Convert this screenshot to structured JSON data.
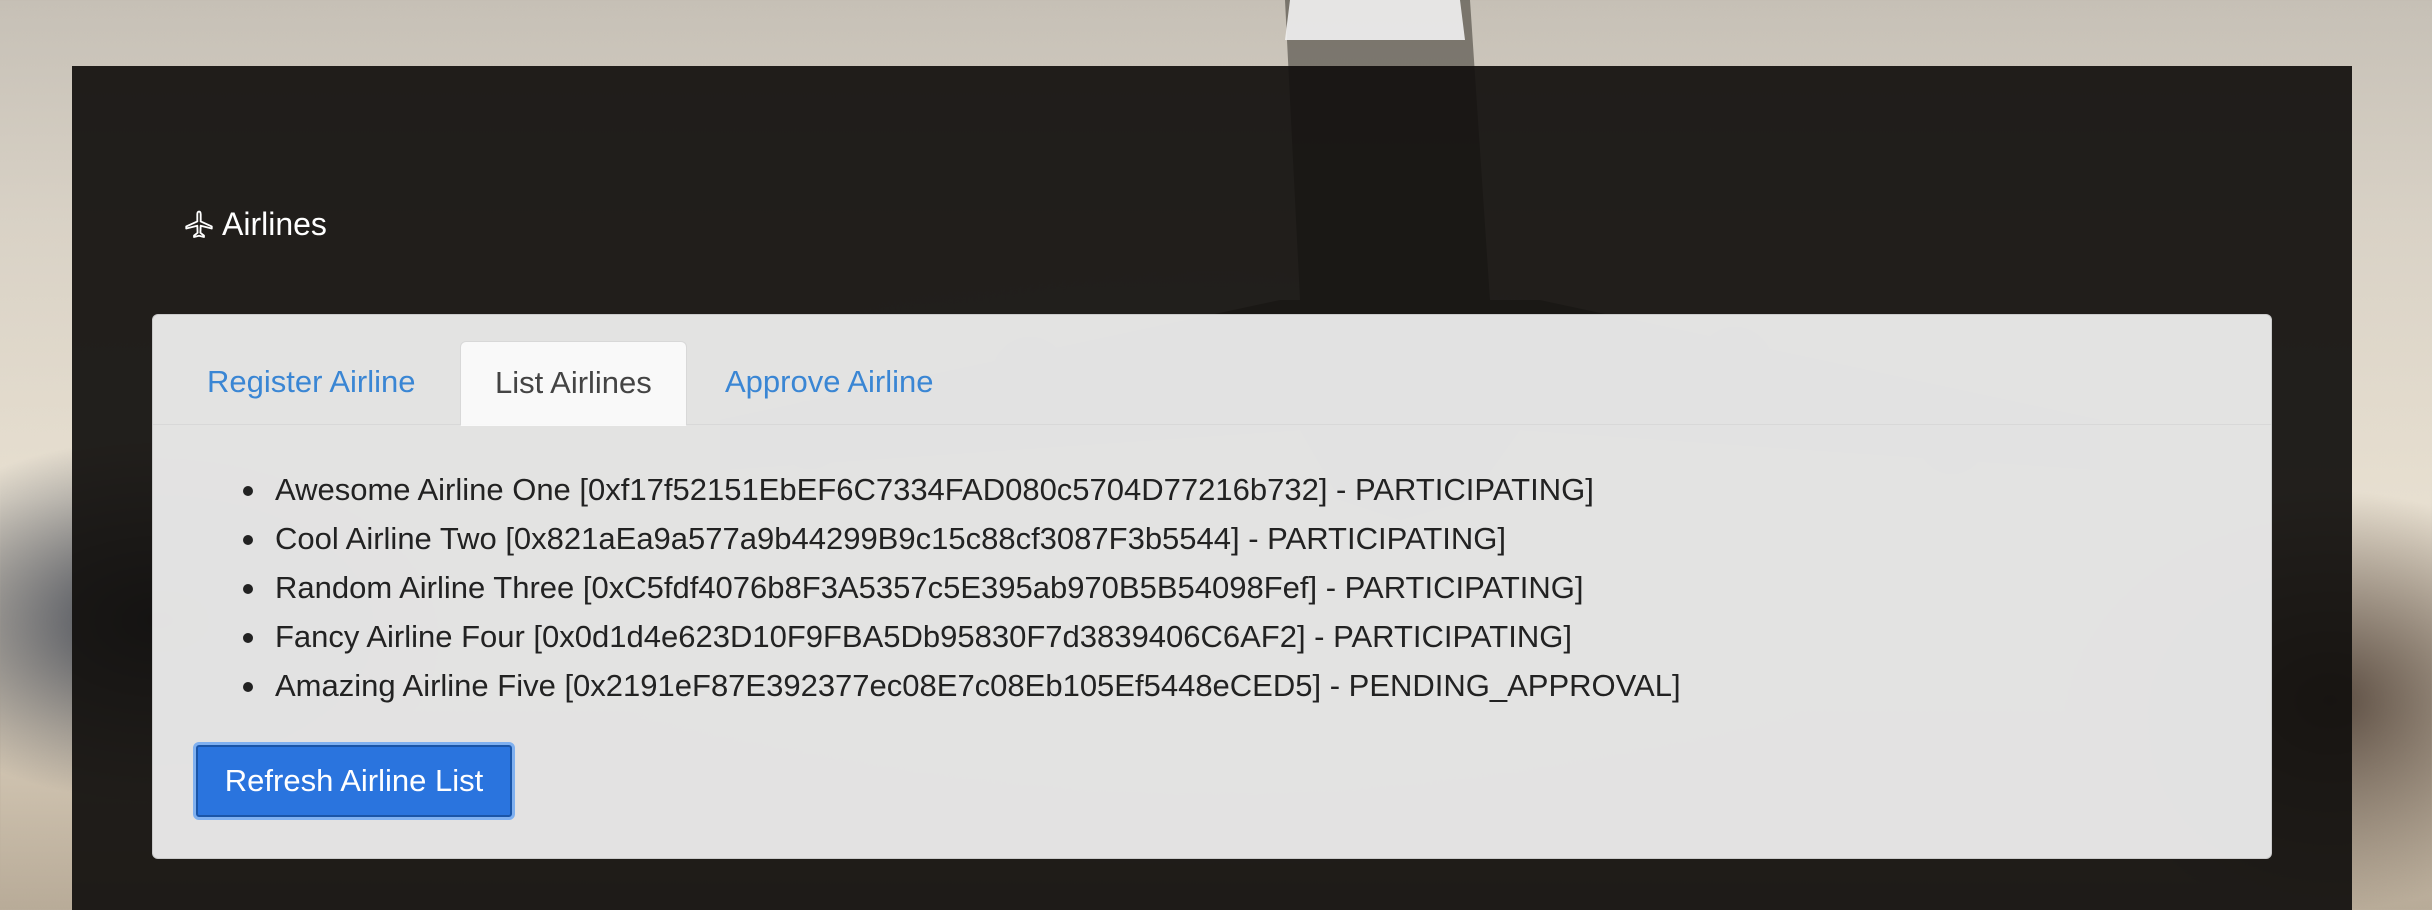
{
  "brand": {
    "icon": "airplane-icon",
    "title": "Airlines"
  },
  "tabs": [
    {
      "label": "Register Airline",
      "active": false
    },
    {
      "label": "List Airlines",
      "active": true
    },
    {
      "label": "Approve Airline",
      "active": false
    }
  ],
  "airlines": [
    {
      "text": "Awesome Airline One [0xf17f52151EbEF6C7334FAD080c5704D77216b732] - PARTICIPATING]"
    },
    {
      "text": "Cool Airline Two [0x821aEa9a577a9b44299B9c15c88cf3087F3b5544] - PARTICIPATING]"
    },
    {
      "text": "Random Airline Three [0xC5fdf4076b8F3A5357c5E395ab970B5B54098Fef] - PARTICIPATING]"
    },
    {
      "text": "Fancy Airline Four [0x0d1d4e623D10F9FBA5Db95830F7d3839406C6AF2] - PARTICIPATING]"
    },
    {
      "text": "Amazing Airline Five [0x2191eF87E392377ec08E7c08Eb105Ef5448eCED5] - PENDING_APPROVAL]"
    }
  ],
  "actions": {
    "refresh_label": "Refresh Airline List"
  },
  "colors": {
    "link": "#3a86d4",
    "primary_button": "#2a74de",
    "panel": "#12100e"
  }
}
